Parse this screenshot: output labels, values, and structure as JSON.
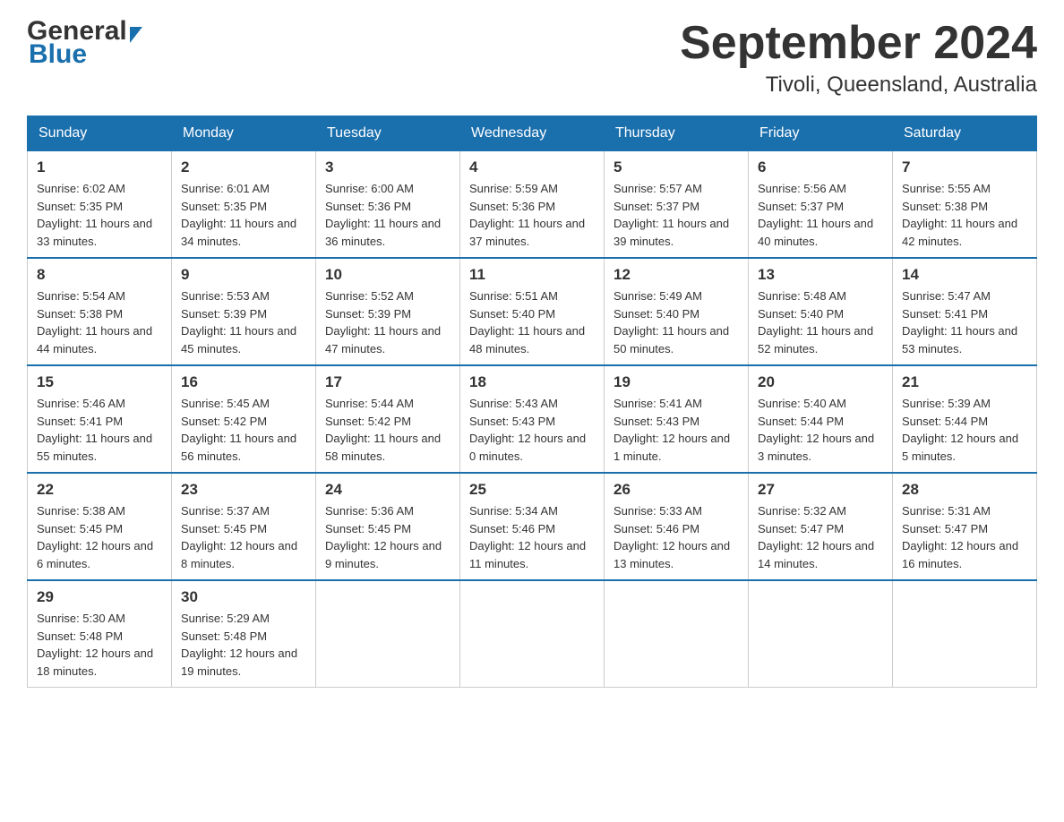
{
  "header": {
    "title": "September 2024",
    "location": "Tivoli, Queensland, Australia"
  },
  "logo": {
    "general": "General",
    "blue": "Blue"
  },
  "days": [
    "Sunday",
    "Monday",
    "Tuesday",
    "Wednesday",
    "Thursday",
    "Friday",
    "Saturday"
  ],
  "weeks": [
    [
      {
        "date": "1",
        "sunrise": "6:02 AM",
        "sunset": "5:35 PM",
        "daylight": "11 hours and 33 minutes."
      },
      {
        "date": "2",
        "sunrise": "6:01 AM",
        "sunset": "5:35 PM",
        "daylight": "11 hours and 34 minutes."
      },
      {
        "date": "3",
        "sunrise": "6:00 AM",
        "sunset": "5:36 PM",
        "daylight": "11 hours and 36 minutes."
      },
      {
        "date": "4",
        "sunrise": "5:59 AM",
        "sunset": "5:36 PM",
        "daylight": "11 hours and 37 minutes."
      },
      {
        "date": "5",
        "sunrise": "5:57 AM",
        "sunset": "5:37 PM",
        "daylight": "11 hours and 39 minutes."
      },
      {
        "date": "6",
        "sunrise": "5:56 AM",
        "sunset": "5:37 PM",
        "daylight": "11 hours and 40 minutes."
      },
      {
        "date": "7",
        "sunrise": "5:55 AM",
        "sunset": "5:38 PM",
        "daylight": "11 hours and 42 minutes."
      }
    ],
    [
      {
        "date": "8",
        "sunrise": "5:54 AM",
        "sunset": "5:38 PM",
        "daylight": "11 hours and 44 minutes."
      },
      {
        "date": "9",
        "sunrise": "5:53 AM",
        "sunset": "5:39 PM",
        "daylight": "11 hours and 45 minutes."
      },
      {
        "date": "10",
        "sunrise": "5:52 AM",
        "sunset": "5:39 PM",
        "daylight": "11 hours and 47 minutes."
      },
      {
        "date": "11",
        "sunrise": "5:51 AM",
        "sunset": "5:40 PM",
        "daylight": "11 hours and 48 minutes."
      },
      {
        "date": "12",
        "sunrise": "5:49 AM",
        "sunset": "5:40 PM",
        "daylight": "11 hours and 50 minutes."
      },
      {
        "date": "13",
        "sunrise": "5:48 AM",
        "sunset": "5:40 PM",
        "daylight": "11 hours and 52 minutes."
      },
      {
        "date": "14",
        "sunrise": "5:47 AM",
        "sunset": "5:41 PM",
        "daylight": "11 hours and 53 minutes."
      }
    ],
    [
      {
        "date": "15",
        "sunrise": "5:46 AM",
        "sunset": "5:41 PM",
        "daylight": "11 hours and 55 minutes."
      },
      {
        "date": "16",
        "sunrise": "5:45 AM",
        "sunset": "5:42 PM",
        "daylight": "11 hours and 56 minutes."
      },
      {
        "date": "17",
        "sunrise": "5:44 AM",
        "sunset": "5:42 PM",
        "daylight": "11 hours and 58 minutes."
      },
      {
        "date": "18",
        "sunrise": "5:43 AM",
        "sunset": "5:43 PM",
        "daylight": "12 hours and 0 minutes."
      },
      {
        "date": "19",
        "sunrise": "5:41 AM",
        "sunset": "5:43 PM",
        "daylight": "12 hours and 1 minute."
      },
      {
        "date": "20",
        "sunrise": "5:40 AM",
        "sunset": "5:44 PM",
        "daylight": "12 hours and 3 minutes."
      },
      {
        "date": "21",
        "sunrise": "5:39 AM",
        "sunset": "5:44 PM",
        "daylight": "12 hours and 5 minutes."
      }
    ],
    [
      {
        "date": "22",
        "sunrise": "5:38 AM",
        "sunset": "5:45 PM",
        "daylight": "12 hours and 6 minutes."
      },
      {
        "date": "23",
        "sunrise": "5:37 AM",
        "sunset": "5:45 PM",
        "daylight": "12 hours and 8 minutes."
      },
      {
        "date": "24",
        "sunrise": "5:36 AM",
        "sunset": "5:45 PM",
        "daylight": "12 hours and 9 minutes."
      },
      {
        "date": "25",
        "sunrise": "5:34 AM",
        "sunset": "5:46 PM",
        "daylight": "12 hours and 11 minutes."
      },
      {
        "date": "26",
        "sunrise": "5:33 AM",
        "sunset": "5:46 PM",
        "daylight": "12 hours and 13 minutes."
      },
      {
        "date": "27",
        "sunrise": "5:32 AM",
        "sunset": "5:47 PM",
        "daylight": "12 hours and 14 minutes."
      },
      {
        "date": "28",
        "sunrise": "5:31 AM",
        "sunset": "5:47 PM",
        "daylight": "12 hours and 16 minutes."
      }
    ],
    [
      {
        "date": "29",
        "sunrise": "5:30 AM",
        "sunset": "5:48 PM",
        "daylight": "12 hours and 18 minutes."
      },
      {
        "date": "30",
        "sunrise": "5:29 AM",
        "sunset": "5:48 PM",
        "daylight": "12 hours and 19 minutes."
      },
      null,
      null,
      null,
      null,
      null
    ]
  ]
}
